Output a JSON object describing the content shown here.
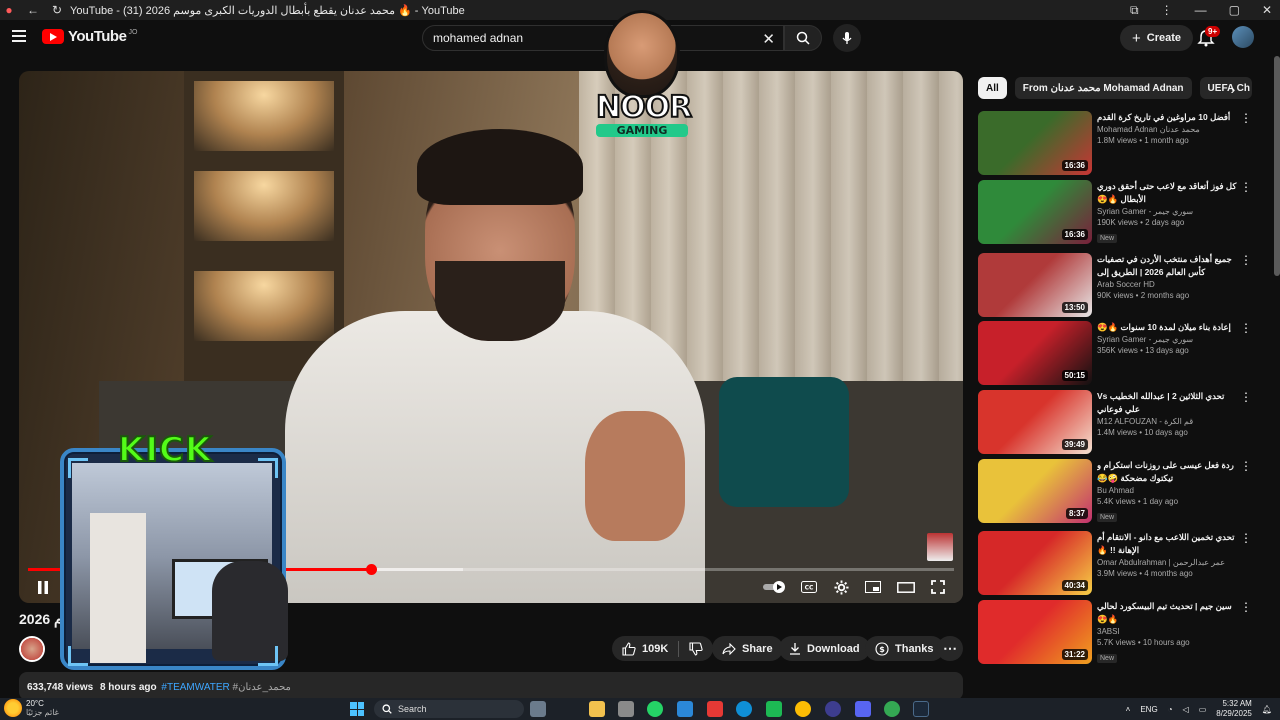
{
  "window": {
    "title": "YouTube - (31) محمد عدنان يقطع بأبطال الدوريات الكبرى موسم 2026 🔥 - YouTube"
  },
  "header": {
    "logo": "YouTube",
    "country": "JO",
    "search_value": "mohamed adnan",
    "create_label": "Create",
    "notif_count": "9+"
  },
  "overlay": {
    "noor_line1": "NOOR",
    "noor_line2": "GAMING",
    "kick": "KICK"
  },
  "player": {
    "progress_fraction": 0.37,
    "buffered_fraction": 0.47
  },
  "video": {
    "title_fragment": "م 2026",
    "likes": "109K",
    "share": "Share",
    "download": "Download",
    "thanks": "Thanks",
    "views": "633,748 views",
    "time": "8 hours ago",
    "tag": "#TEAMWATER",
    "tag2": "#محمد_عدنان"
  },
  "chips": [
    "All",
    "From محمد عدنان Mohamad Adnan",
    "UEFA Ch"
  ],
  "recommendations": [
    {
      "title": "أفضل 10 مراوغين في تاريخ كرة القدم",
      "channel": "Mohamad Adnan محمد عدنان",
      "meta": "1.8M views • 1 month ago",
      "duration": "16:36",
      "new": "",
      "colors": [
        "#3a6b2a",
        "#c93535"
      ]
    },
    {
      "title": "كل فوز أتعاقد مع لاعب حتى أحقق دوري الأبطال 🔥😍",
      "channel": "Syrian Gamer - سوري جيمر",
      "meta": "190K views • 2 days ago",
      "duration": "16:36",
      "new": "New",
      "colors": [
        "#2f8a3a",
        "#7a1f3b"
      ]
    },
    {
      "title": "جميع أهداف منتخب الأردن في تصفيات كأس العالم 2026 | الطريق إلى المونديال",
      "channel": "Arab Soccer HD",
      "meta": "90K views • 2 months ago",
      "duration": "13:50",
      "new": "",
      "colors": [
        "#b03a3a",
        "#e8e8e8"
      ]
    },
    {
      "title": "إعادة بناء ميلان لمدة 10 سنوات 🔥😍",
      "channel": "Syrian Gamer - سوري جيمر",
      "meta": "356K views • 13 days ago",
      "duration": "50:15",
      "new": "",
      "colors": [
        "#c7202a",
        "#111111"
      ]
    },
    {
      "title": "تحدي الثلاثين 2 | عبدالله الخطيب Vs علي فوعاني",
      "channel": "M12 ALFOUZAN - قم الكرة",
      "meta": "1.4M views • 10 days ago",
      "duration": "39:49",
      "new": "",
      "colors": [
        "#d8342c",
        "#f4e2d2"
      ]
    },
    {
      "title": "ردة فعل عيسى على روزنات استكرام و تيكتوك مضحكة 🤪😂",
      "channel": "Bu Ahmad",
      "meta": "5.4K views • 1 day ago",
      "duration": "8:37",
      "new": "New",
      "colors": [
        "#e9c23a",
        "#c23070"
      ]
    },
    {
      "title": "تحدي تخمين اللاعب مع دانو - الانتقام أم الإهانة !! 🔥",
      "channel": "Omar Abdulrahman | عمر عبدالرحمن",
      "meta": "3.9M views • 4 months ago",
      "duration": "40:34",
      "new": "",
      "colors": [
        "#d62828",
        "#f7d046"
      ]
    },
    {
      "title": "سين جيم | تحديث تيم البيسكورد لحالي 🔥😍",
      "channel": "3ABSI",
      "meta": "5.7K views • 10 hours ago",
      "duration": "31:22",
      "new": "New",
      "colors": [
        "#e02b2b",
        "#f0a020"
      ]
    }
  ],
  "taskbar": {
    "temp": "20°C",
    "weather_label": "غائم جزئيًا",
    "search_label": "Search",
    "lang": "ENG",
    "time": "5:32 AM",
    "date": "8/29/2025"
  }
}
